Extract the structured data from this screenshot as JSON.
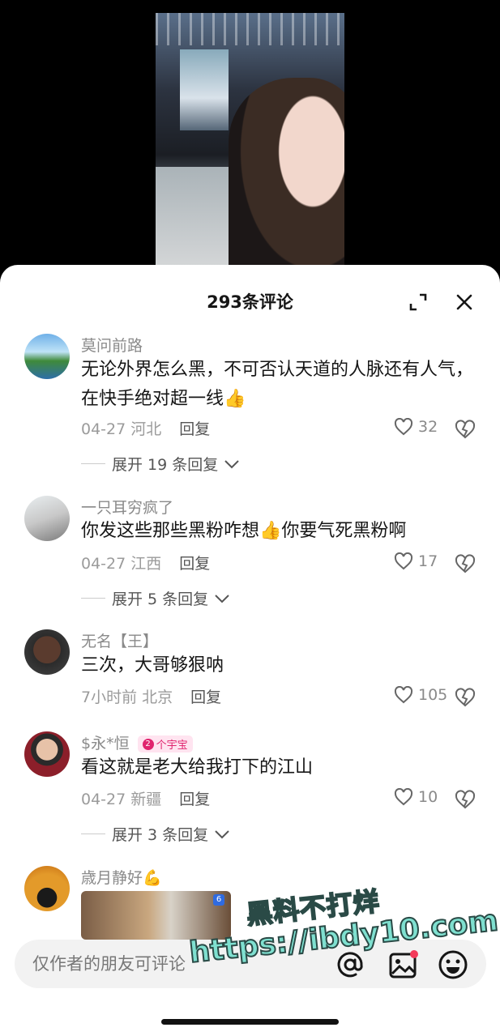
{
  "header": {
    "title": "293条评论"
  },
  "comments": [
    {
      "username": "莫问前路",
      "text": "无论外界怎么黑，不可否认天道的人脉还有人气，在快手绝对超一线👍",
      "meta": "04-27 河北",
      "reply_label": "回复",
      "likes": "32",
      "expand_label": "展开 19 条回复"
    },
    {
      "username": "一只耳穷疯了",
      "text": "你发这些那些黑粉咋想👍你要气死黑粉啊",
      "meta": "04-27 江西",
      "reply_label": "回复",
      "likes": "17",
      "expand_label": "展开 5 条回复"
    },
    {
      "username": "无名【王】",
      "text": "三次，大哥够狠呐",
      "meta": "7小时前 北京",
      "reply_label": "回复",
      "likes": "105"
    },
    {
      "username": "$永*恒",
      "badge": "个宇宝",
      "badge_num": "2",
      "text": "看这就是老大给我打下的江山",
      "meta": "04-27 新疆",
      "reply_label": "回复",
      "likes": "10",
      "expand_label": "展开 3 条回复"
    },
    {
      "username": "歳月静好💪",
      "thumb_badge": "6"
    }
  ],
  "input": {
    "placeholder": "仅作者的朋友可评论"
  },
  "watermark": {
    "line1": "黑料不打烊",
    "line2": "https://ibdy10.com"
  },
  "colors": {
    "accent_pink": "#e0246e",
    "background": "#ffffff",
    "text_primary": "#161616",
    "text_secondary": "#8a8a8a"
  }
}
